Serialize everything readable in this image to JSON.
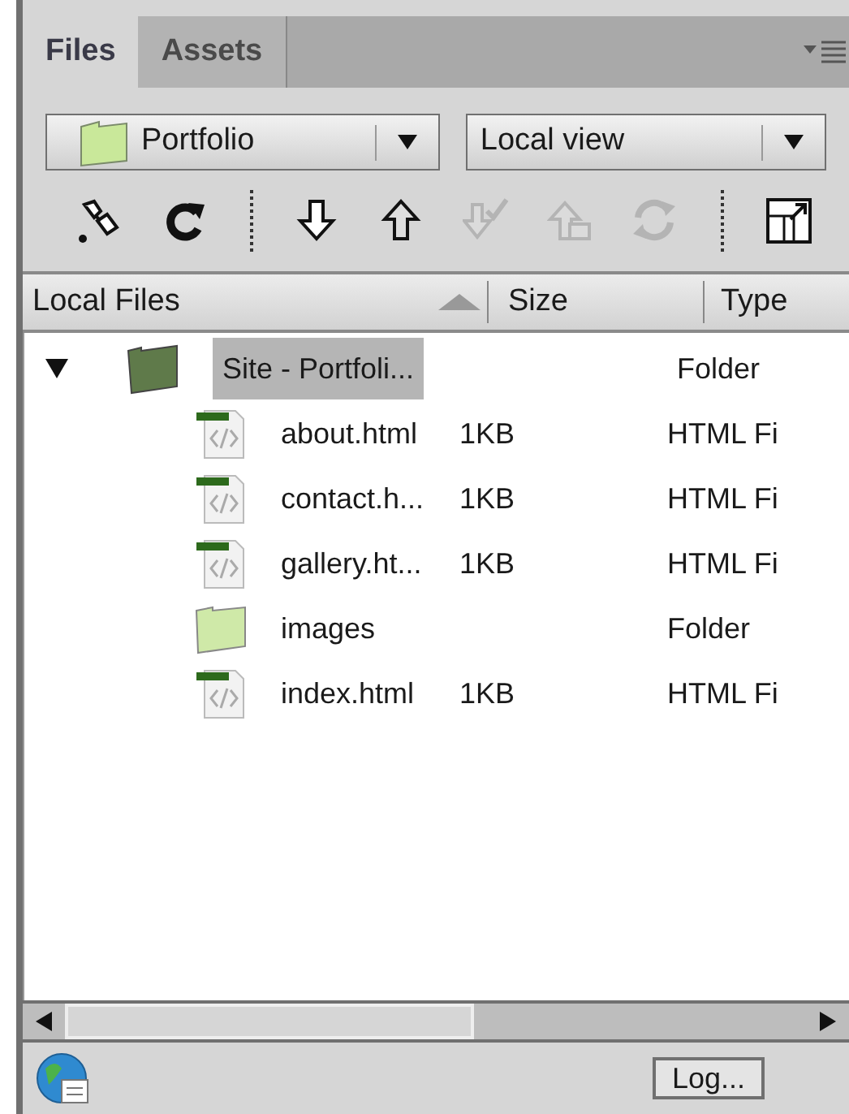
{
  "tabs": [
    {
      "label": "Files",
      "selected": true
    },
    {
      "label": "Assets",
      "selected": false
    }
  ],
  "site_select": {
    "value": "Portfolio"
  },
  "view_select": {
    "value": "Local view"
  },
  "toolbar": [
    {
      "kind": "connect",
      "disabled": false
    },
    {
      "kind": "refresh",
      "disabled": false
    },
    {
      "kind": "separator"
    },
    {
      "kind": "get",
      "disabled": false
    },
    {
      "kind": "put",
      "disabled": false
    },
    {
      "kind": "checkout",
      "disabled": true
    },
    {
      "kind": "checkin",
      "disabled": true
    },
    {
      "kind": "sync",
      "disabled": true
    },
    {
      "kind": "separator"
    },
    {
      "kind": "expand",
      "disabled": false
    }
  ],
  "table": {
    "columns": [
      "Local Files",
      "Size",
      "Type"
    ],
    "rows": [
      {
        "kind": "site",
        "name": "Site - Portfoli...",
        "type": "Folder",
        "selected": true,
        "expanded": true,
        "children": [
          {
            "kind": "html",
            "name": "about.html",
            "size": "1KB",
            "type": "HTML Fi",
            "selected": false
          },
          {
            "kind": "html",
            "name": "contact.h...",
            "size": "1KB",
            "type": "HTML Fi",
            "selected": false
          },
          {
            "kind": "html",
            "name": "gallery.ht...",
            "size": "1KB",
            "type": "HTML Fi",
            "selected": false
          },
          {
            "kind": "folder",
            "name": "images",
            "type": "Folder",
            "selected": false
          },
          {
            "kind": "html",
            "name": "index.html",
            "size": "1KB",
            "type": "HTML Fi",
            "selected": false
          }
        ]
      }
    ]
  },
  "log_button": "Log..."
}
